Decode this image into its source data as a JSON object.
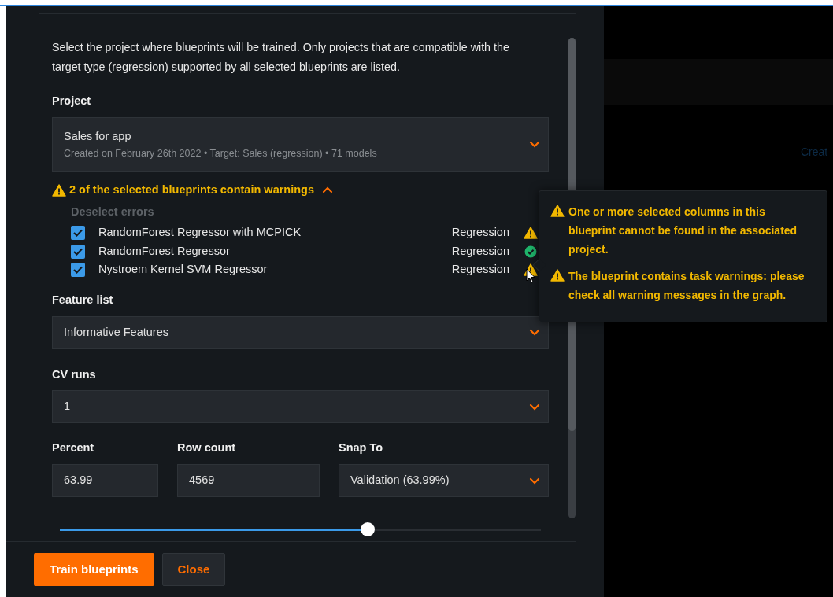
{
  "dialog": {
    "intro": "Select the project where blueprints will be trained. Only projects that are compatible with the target type (regression) supported by all selected blueprints are listed.",
    "project": {
      "label": "Project",
      "value": "Sales for app",
      "details": "Created on February 26th 2022 • Target: Sales (regression) • 71 models"
    },
    "warnings": {
      "summary": "2 of the selected blueprints contain warnings",
      "expanded": true,
      "deselect": "Deselect errors",
      "deselect_disabled": true,
      "blueprints": [
        {
          "name": "RandomForest Regressor with MCPICK",
          "target": "Regression",
          "checked": true,
          "kind": "warning"
        },
        {
          "name": "RandomForest Regressor",
          "target": "Regression",
          "checked": true,
          "kind": "ok"
        },
        {
          "name": "Nystroem Kernel SVM Regressor",
          "target": "Regression",
          "checked": true,
          "kind": "warning"
        }
      ]
    },
    "feature_list": {
      "label": "Feature list",
      "value": "Informative Features"
    },
    "cv_runs": {
      "label": "CV runs",
      "value": "1"
    },
    "percent": {
      "label": "Percent",
      "value": "63.99"
    },
    "row_count": {
      "label": "Row count",
      "value": "4569"
    },
    "snap_to": {
      "label": "Snap To",
      "value": "Validation (63.99%)"
    },
    "sample_slider": {
      "level": 0.64
    },
    "buttons": [
      {
        "label": "Train blueprints",
        "kind": "primary"
      },
      {
        "label": "Close",
        "kind": "secondary"
      }
    ]
  },
  "tooltip": {
    "messages": [
      "One or more selected columns in this blueprint cannot be found in the associated project.",
      "The blueprint contains task warnings: please check all warning messages in the graph."
    ]
  },
  "background": {
    "link": "Creat"
  }
}
